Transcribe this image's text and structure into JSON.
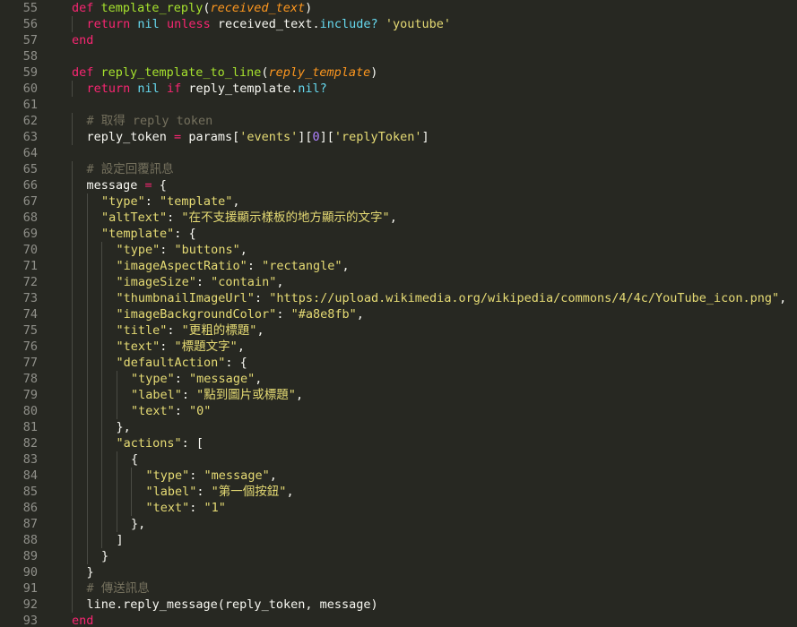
{
  "editor": {
    "theme": "monokai",
    "colors": {
      "background": "#272822",
      "gutter_text": "#90908a",
      "text": "#f8f8f2",
      "keyword": "#f92672",
      "function": "#a6e22e",
      "parameter": "#fd971f",
      "string": "#e6db74",
      "comment": "#75715e",
      "number": "#ae81ff",
      "builtin": "#66d9ef"
    },
    "lines": [
      {
        "num": "55",
        "indent": 0,
        "tokens": [
          [
            "kw",
            "def"
          ],
          [
            "t",
            " "
          ],
          [
            "fn",
            "template_reply"
          ],
          [
            "t",
            "("
          ],
          [
            "pa",
            "received_text"
          ],
          [
            "t",
            ")"
          ]
        ]
      },
      {
        "num": "56",
        "indent": 1,
        "tokens": [
          [
            "kw",
            "return"
          ],
          [
            "t",
            " "
          ],
          [
            "bi",
            "nil"
          ],
          [
            "t",
            " "
          ],
          [
            "kw",
            "unless"
          ],
          [
            "t",
            " received_text."
          ],
          [
            "bi",
            "include?"
          ],
          [
            "t",
            " "
          ],
          [
            "st",
            "'youtube'"
          ]
        ]
      },
      {
        "num": "57",
        "indent": 0,
        "tokens": [
          [
            "kw",
            "end"
          ]
        ]
      },
      {
        "num": "58",
        "indent": 0,
        "tokens": []
      },
      {
        "num": "59",
        "indent": 0,
        "tokens": [
          [
            "kw",
            "def"
          ],
          [
            "t",
            " "
          ],
          [
            "fn",
            "reply_template_to_line"
          ],
          [
            "t",
            "("
          ],
          [
            "pa",
            "reply_template"
          ],
          [
            "t",
            ")"
          ]
        ]
      },
      {
        "num": "60",
        "indent": 1,
        "tokens": [
          [
            "kw",
            "return"
          ],
          [
            "t",
            " "
          ],
          [
            "bi",
            "nil"
          ],
          [
            "t",
            " "
          ],
          [
            "kw",
            "if"
          ],
          [
            "t",
            " reply_template."
          ],
          [
            "bi",
            "nil?"
          ]
        ]
      },
      {
        "num": "61",
        "indent": 0,
        "tokens": []
      },
      {
        "num": "62",
        "indent": 1,
        "tokens": [
          [
            "co",
            "# 取得 reply token"
          ]
        ]
      },
      {
        "num": "63",
        "indent": 1,
        "tokens": [
          [
            "t",
            "reply_token "
          ],
          [
            "op",
            "="
          ],
          [
            "t",
            " params["
          ],
          [
            "st",
            "'events'"
          ],
          [
            "t",
            "]["
          ],
          [
            "nu",
            "0"
          ],
          [
            "t",
            "]["
          ],
          [
            "st",
            "'replyToken'"
          ],
          [
            "t",
            "]"
          ]
        ]
      },
      {
        "num": "64",
        "indent": 0,
        "tokens": []
      },
      {
        "num": "65",
        "indent": 1,
        "tokens": [
          [
            "co",
            "# 設定回覆訊息"
          ]
        ]
      },
      {
        "num": "66",
        "indent": 1,
        "tokens": [
          [
            "t",
            "message "
          ],
          [
            "op",
            "="
          ],
          [
            "t",
            " {"
          ]
        ]
      },
      {
        "num": "67",
        "indent": 2,
        "tokens": [
          [
            "st",
            "\"type\""
          ],
          [
            "t",
            ": "
          ],
          [
            "st",
            "\"template\""
          ],
          [
            "t",
            ","
          ]
        ]
      },
      {
        "num": "68",
        "indent": 2,
        "tokens": [
          [
            "st",
            "\"altText\""
          ],
          [
            "t",
            ": "
          ],
          [
            "st",
            "\"在不支援顯示樣板的地方顯示的文字\""
          ],
          [
            "t",
            ","
          ]
        ]
      },
      {
        "num": "69",
        "indent": 2,
        "tokens": [
          [
            "st",
            "\"template\""
          ],
          [
            "t",
            ": {"
          ]
        ]
      },
      {
        "num": "70",
        "indent": 3,
        "tokens": [
          [
            "st",
            "\"type\""
          ],
          [
            "t",
            ": "
          ],
          [
            "st",
            "\"buttons\""
          ],
          [
            "t",
            ","
          ]
        ]
      },
      {
        "num": "71",
        "indent": 3,
        "tokens": [
          [
            "st",
            "\"imageAspectRatio\""
          ],
          [
            "t",
            ": "
          ],
          [
            "st",
            "\"rectangle\""
          ],
          [
            "t",
            ","
          ]
        ]
      },
      {
        "num": "72",
        "indent": 3,
        "tokens": [
          [
            "st",
            "\"imageSize\""
          ],
          [
            "t",
            ": "
          ],
          [
            "st",
            "\"contain\""
          ],
          [
            "t",
            ","
          ]
        ]
      },
      {
        "num": "73",
        "indent": 3,
        "tokens": [
          [
            "st",
            "\"thumbnailImageUrl\""
          ],
          [
            "t",
            ": "
          ],
          [
            "st",
            "\"https://upload.wikimedia.org/wikipedia/commons/4/4c/YouTube_icon.png\""
          ],
          [
            "t",
            ","
          ]
        ]
      },
      {
        "num": "74",
        "indent": 3,
        "tokens": [
          [
            "st",
            "\"imageBackgroundColor\""
          ],
          [
            "t",
            ": "
          ],
          [
            "st",
            "\"#a8e8fb\""
          ],
          [
            "t",
            ","
          ]
        ]
      },
      {
        "num": "75",
        "indent": 3,
        "tokens": [
          [
            "st",
            "\"title\""
          ],
          [
            "t",
            ": "
          ],
          [
            "st",
            "\"更粗的標題\""
          ],
          [
            "t",
            ","
          ]
        ]
      },
      {
        "num": "76",
        "indent": 3,
        "tokens": [
          [
            "st",
            "\"text\""
          ],
          [
            "t",
            ": "
          ],
          [
            "st",
            "\"標題文字\""
          ],
          [
            "t",
            ","
          ]
        ]
      },
      {
        "num": "77",
        "indent": 3,
        "tokens": [
          [
            "st",
            "\"defaultAction\""
          ],
          [
            "t",
            ": {"
          ]
        ]
      },
      {
        "num": "78",
        "indent": 4,
        "tokens": [
          [
            "st",
            "\"type\""
          ],
          [
            "t",
            ": "
          ],
          [
            "st",
            "\"message\""
          ],
          [
            "t",
            ","
          ]
        ]
      },
      {
        "num": "79",
        "indent": 4,
        "tokens": [
          [
            "st",
            "\"label\""
          ],
          [
            "t",
            ": "
          ],
          [
            "st",
            "\"點到圖片或標題\""
          ],
          [
            "t",
            ","
          ]
        ]
      },
      {
        "num": "80",
        "indent": 4,
        "tokens": [
          [
            "st",
            "\"text\""
          ],
          [
            "t",
            ": "
          ],
          [
            "st",
            "\"0\""
          ]
        ]
      },
      {
        "num": "81",
        "indent": 3,
        "tokens": [
          [
            "t",
            "},"
          ]
        ]
      },
      {
        "num": "82",
        "indent": 3,
        "tokens": [
          [
            "st",
            "\"actions\""
          ],
          [
            "t",
            ": ["
          ]
        ]
      },
      {
        "num": "83",
        "indent": 4,
        "tokens": [
          [
            "t",
            "{"
          ]
        ]
      },
      {
        "num": "84",
        "indent": 5,
        "tokens": [
          [
            "st",
            "\"type\""
          ],
          [
            "t",
            ": "
          ],
          [
            "st",
            "\"message\""
          ],
          [
            "t",
            ","
          ]
        ]
      },
      {
        "num": "85",
        "indent": 5,
        "tokens": [
          [
            "st",
            "\"label\""
          ],
          [
            "t",
            ": "
          ],
          [
            "st",
            "\"第一個按鈕\""
          ],
          [
            "t",
            ","
          ]
        ]
      },
      {
        "num": "86",
        "indent": 5,
        "tokens": [
          [
            "st",
            "\"text\""
          ],
          [
            "t",
            ": "
          ],
          [
            "st",
            "\"1\""
          ]
        ]
      },
      {
        "num": "87",
        "indent": 4,
        "tokens": [
          [
            "t",
            "},"
          ]
        ]
      },
      {
        "num": "88",
        "indent": 3,
        "tokens": [
          [
            "t",
            "]"
          ]
        ]
      },
      {
        "num": "89",
        "indent": 2,
        "tokens": [
          [
            "t",
            "}"
          ]
        ]
      },
      {
        "num": "90",
        "indent": 1,
        "tokens": [
          [
            "t",
            "}"
          ]
        ]
      },
      {
        "num": "91",
        "indent": 1,
        "tokens": [
          [
            "co",
            "# 傳送訊息"
          ]
        ]
      },
      {
        "num": "92",
        "indent": 1,
        "tokens": [
          [
            "t",
            "line.reply_message(reply_token, message)"
          ]
        ]
      },
      {
        "num": "93",
        "indent": 0,
        "tokens": [
          [
            "kw",
            "end"
          ]
        ]
      }
    ]
  }
}
